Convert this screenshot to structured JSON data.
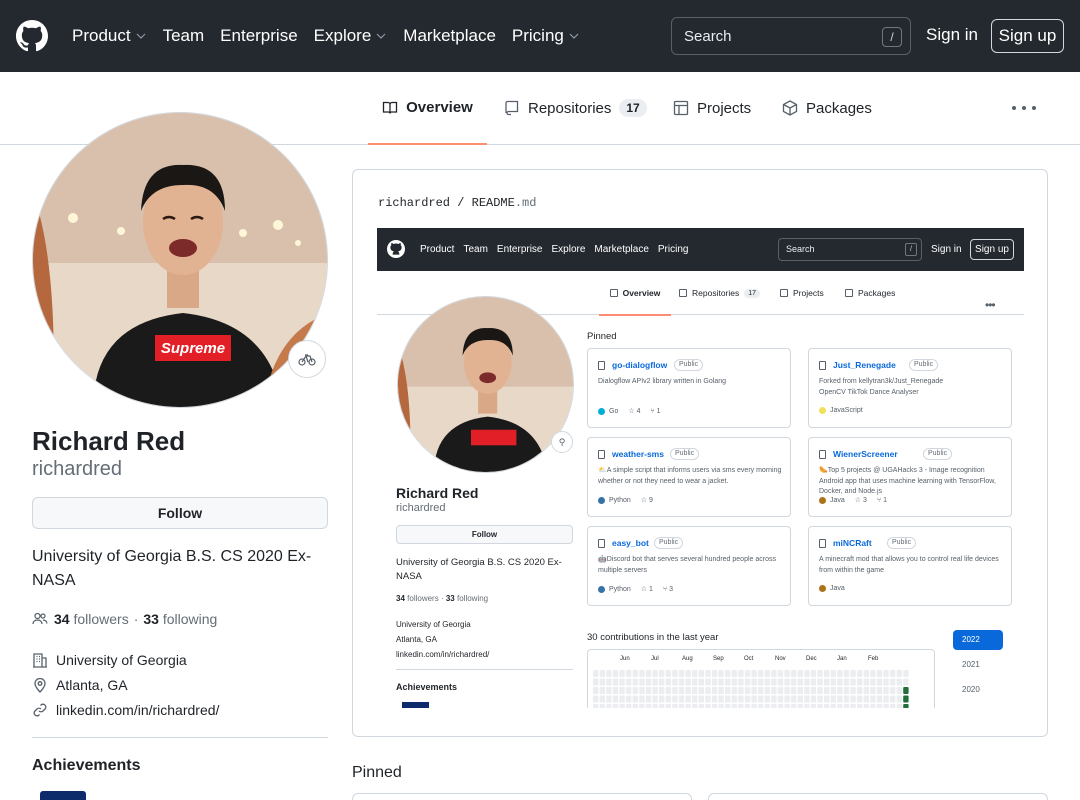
{
  "header": {
    "nav": [
      {
        "label": "Product",
        "dropdown": true
      },
      {
        "label": "Team",
        "dropdown": false
      },
      {
        "label": "Enterprise",
        "dropdown": false
      },
      {
        "label": "Explore",
        "dropdown": true
      },
      {
        "label": "Marketplace",
        "dropdown": false
      },
      {
        "label": "Pricing",
        "dropdown": true
      }
    ],
    "search_placeholder": "Search",
    "search_shortcut": "/",
    "sign_in": "Sign in",
    "sign_up": "Sign up"
  },
  "tabs": {
    "overview": "Overview",
    "repositories": "Repositories",
    "repositories_count": "17",
    "projects": "Projects",
    "packages": "Packages"
  },
  "profile": {
    "name": "Richard Red",
    "login": "richardred",
    "follow_label": "Follow",
    "bio": "University of Georgia B.S. CS 2020 Ex-NASA",
    "followers_count": "34",
    "followers_label": "followers",
    "separator": "·",
    "following_count": "33",
    "following_label": "following",
    "organization": "University of Georgia",
    "location": "Atlanta, GA",
    "website": "linkedin.com/in/richardred/",
    "achievements_title": "Achievements"
  },
  "readme": {
    "owner": "richardred",
    "slash": "/",
    "file": "README",
    "ext": ".md"
  },
  "mini": {
    "nav": [
      "Product",
      "Team",
      "Enterprise",
      "Explore",
      "Marketplace",
      "Pricing"
    ],
    "search": "Search",
    "shortcut": "/",
    "sign_in": "Sign in",
    "sign_up": "Sign up",
    "tabs": {
      "overview": "Overview",
      "repositories": "Repositories",
      "count": "17",
      "projects": "Projects",
      "packages": "Packages"
    },
    "name": "Richard Red",
    "login": "richardred",
    "follow": "Follow",
    "bio": "University of Georgia B.S. CS 2020 Ex-NASA",
    "followers_count": "34",
    "followers_label": "followers",
    "separator": "·",
    "following_count": "33",
    "following_label": "following",
    "organization": "University of Georgia",
    "location": "Atlanta, GA",
    "website": "linkedin.com/in/richardred/",
    "achievements": "Achievements",
    "pinned_title": "Pinned",
    "public_label": "Public",
    "pinned": [
      {
        "name": "go-dialogflow",
        "desc": "Dialogflow APIv2 library written in Golang",
        "lang": "Go",
        "lang_color": "#00add8",
        "stars": "4",
        "forks": "1"
      },
      {
        "name": "Just_Renegade",
        "desc": "Forked from kellytran3k/Just_Renegade\nOpenCV TikTok Dance Analyser",
        "lang": "JavaScript",
        "lang_color": "#f1e05a",
        "stars": "",
        "forks": ""
      },
      {
        "name": "weather-sms",
        "desc": "⛅A simple script that informs users via sms every morning whether or not they need to wear a jacket.",
        "lang": "Python",
        "lang_color": "#3572a5",
        "stars": "9",
        "forks": ""
      },
      {
        "name": "WienerScreener",
        "desc": "🌭Top 5 projects @ UGAHacks 3 - Image recognition Android app that uses machine learning with TensorFlow, Docker, and Node.js",
        "lang": "Java",
        "lang_color": "#b07219",
        "stars": "3",
        "forks": "1"
      },
      {
        "name": "easy_bot",
        "desc": "🤖Discord bot that serves several hundred people across multiple servers",
        "lang": "Python",
        "lang_color": "#3572a5",
        "stars": "1",
        "forks": "3"
      },
      {
        "name": "miNCRaft",
        "desc": "A minecraft mod that allows you to control real life devices from within the game",
        "lang": "Java",
        "lang_color": "#b07219",
        "stars": "",
        "forks": ""
      }
    ],
    "contributions": "30 contributions in the last year",
    "months": [
      "Jun",
      "Jul",
      "Aug",
      "Sep",
      "Oct",
      "Nov",
      "Dec",
      "Jan",
      "Feb"
    ],
    "years": [
      "2022",
      "2021",
      "2020"
    ]
  },
  "pinned_title": "Pinned",
  "colors": {
    "header_bg": "#24292f",
    "tab_underline": "#fd8c73",
    "link": "#0969da",
    "contrib_green": "#216e39"
  }
}
